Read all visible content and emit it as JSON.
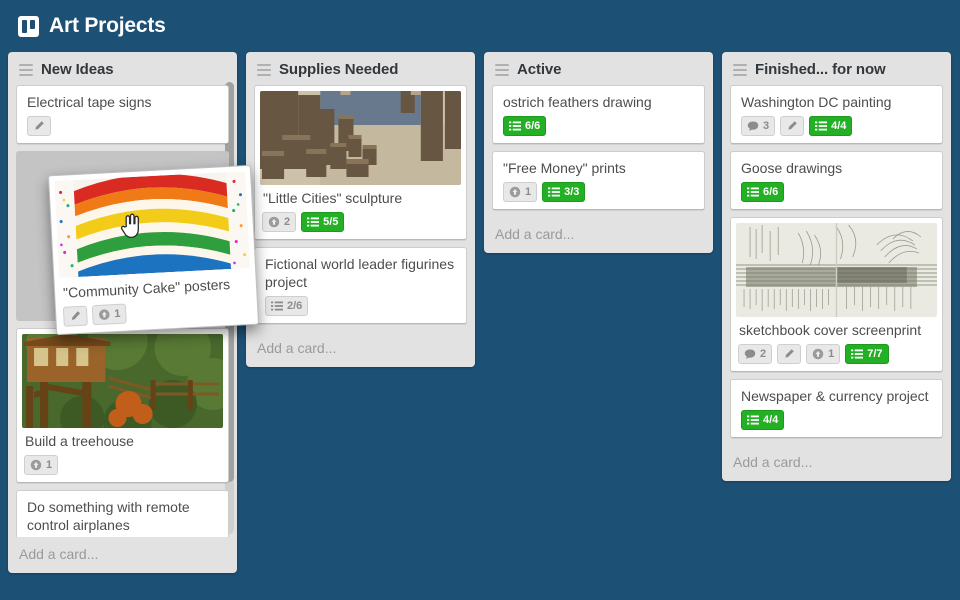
{
  "header": {
    "title": "Art Projects",
    "logo_icon": "board-icon"
  },
  "theme": {
    "board_bg": "#1d5075",
    "list_bg": "#e2e2e2",
    "card_bg": "#ffffff",
    "badge_green": "#23b024",
    "placeholder": "#c4c4c4"
  },
  "add_card_label": "Add a card...",
  "lists": [
    {
      "title": "New Ideas",
      "menu_icon": "hamburger-icon",
      "cards": [
        {
          "title": "Electrical tape signs",
          "badges": [
            {
              "type": "description",
              "icon": "pencil-icon",
              "text": ""
            }
          ]
        },
        {
          "type": "placeholder"
        },
        {
          "title": "Build a treehouse",
          "cover": "treehouse-photo",
          "badges": [
            {
              "type": "votes",
              "icon": "vote-icon",
              "text": "1"
            }
          ]
        },
        {
          "title": "Do something with remote control airplanes",
          "badges": [
            {
              "type": "description",
              "icon": "pencil-icon",
              "text": ""
            }
          ]
        }
      ]
    },
    {
      "title": "Supplies Needed",
      "menu_icon": "hamburger-icon",
      "cards": [
        {
          "title": "\"Little Cities\" sculpture",
          "cover": "cardboard-city-photo",
          "badges": [
            {
              "type": "votes",
              "icon": "vote-icon",
              "text": "2"
            },
            {
              "type": "checklist",
              "icon": "checklist-icon",
              "text": "5/5",
              "complete": true
            }
          ]
        },
        {
          "title": "Fictional world leader figurines project",
          "badges": [
            {
              "type": "checklist",
              "icon": "checklist-icon",
              "text": "2/6",
              "complete": false
            }
          ]
        }
      ]
    },
    {
      "title": "Active",
      "menu_icon": "hamburger-icon",
      "cards": [
        {
          "title": "ostrich feathers drawing",
          "badges": [
            {
              "type": "checklist",
              "icon": "checklist-icon",
              "text": "6/6",
              "complete": true
            }
          ]
        },
        {
          "title": "\"Free Money\" prints",
          "badges": [
            {
              "type": "votes",
              "icon": "vote-icon",
              "text": "1"
            },
            {
              "type": "checklist",
              "icon": "checklist-icon",
              "text": "3/3",
              "complete": true
            }
          ]
        }
      ]
    },
    {
      "title": "Finished... for now",
      "menu_icon": "hamburger-icon",
      "cards": [
        {
          "title": "Washington DC painting",
          "badges": [
            {
              "type": "comments",
              "icon": "comment-icon",
              "text": "3"
            },
            {
              "type": "description",
              "icon": "pencil-icon",
              "text": ""
            },
            {
              "type": "checklist",
              "icon": "checklist-icon",
              "text": "4/4",
              "complete": true
            }
          ]
        },
        {
          "title": "Goose drawings",
          "badges": [
            {
              "type": "checklist",
              "icon": "checklist-icon",
              "text": "6/6",
              "complete": true
            }
          ]
        },
        {
          "title": "sketchbook cover screenprint",
          "cover": "pencil-sketch-photo",
          "badges": [
            {
              "type": "comments",
              "icon": "comment-icon",
              "text": "2"
            },
            {
              "type": "description",
              "icon": "pencil-icon",
              "text": ""
            },
            {
              "type": "votes",
              "icon": "vote-icon",
              "text": "1"
            },
            {
              "type": "checklist",
              "icon": "checklist-icon",
              "text": "7/7",
              "complete": true
            }
          ]
        },
        {
          "title": "Newspaper & currency project",
          "badges": [
            {
              "type": "checklist",
              "icon": "checklist-icon",
              "text": "4/4",
              "complete": true
            }
          ]
        }
      ]
    }
  ],
  "drag_card": {
    "title": "\"Community Cake\" posters",
    "cover": "rainbow-cake-photo",
    "cursor_icon": "grab-hand-cursor",
    "badges": [
      {
        "type": "description",
        "icon": "pencil-icon",
        "text": ""
      },
      {
        "type": "votes",
        "icon": "vote-icon",
        "text": "1"
      }
    ]
  }
}
